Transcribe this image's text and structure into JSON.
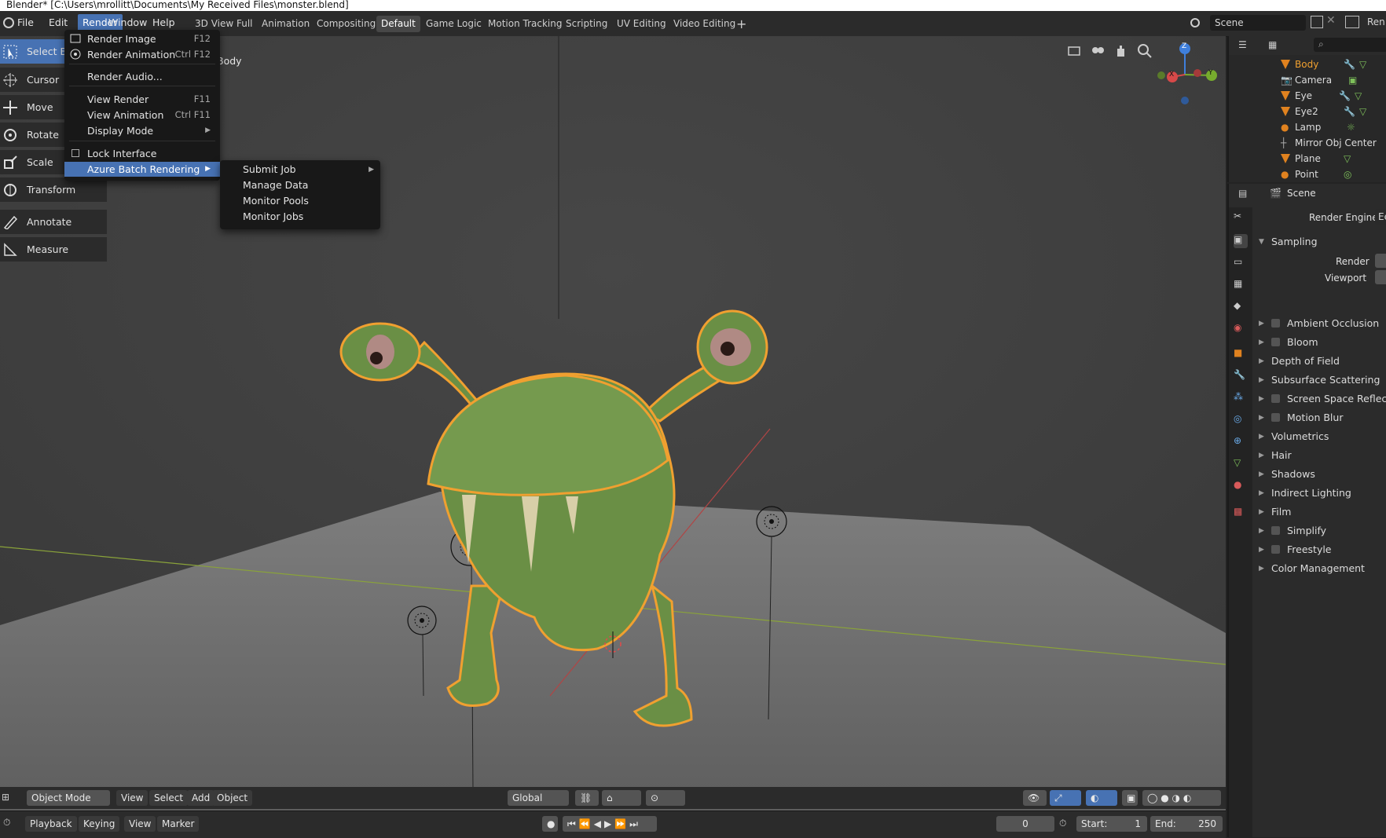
{
  "window": {
    "title": "Blender* [C:\\Users\\mrollitt\\Documents\\My Received Files\\monster.blend]"
  },
  "top_menu": [
    "File",
    "Edit",
    "Render",
    "Window",
    "Help"
  ],
  "workspace_tabs": [
    "3D View Full",
    "Animation",
    "Compositing",
    "Default",
    "Game Logic",
    "Motion Tracking",
    "Scripting",
    "UV Editing",
    "Video Editing"
  ],
  "workspace_active": "Default",
  "scene_selector": {
    "label": "Scene"
  },
  "render_menu": {
    "items": [
      {
        "label": "Render Image",
        "shortcut": "F12",
        "icon": "render-image-icon"
      },
      {
        "label": "Render Animation",
        "shortcut": "Ctrl F12",
        "icon": "render-animation-icon"
      },
      {
        "label": "Render Audio...",
        "shortcut": ""
      },
      {
        "label": "View Render",
        "shortcut": "F11"
      },
      {
        "label": "View Animation",
        "shortcut": "Ctrl F11"
      },
      {
        "label": "Display Mode",
        "shortcut": ""
      },
      {
        "label": "Lock Interface",
        "shortcut": ""
      },
      {
        "label": "Azure Batch Rendering",
        "shortcut": ""
      }
    ]
  },
  "azure_submenu": {
    "items": [
      "Submit Job",
      "Manage Data",
      "Monitor Pools",
      "Monitor Jobs"
    ]
  },
  "toolbar": {
    "tools": [
      "Select Box",
      "Cursor",
      "Move",
      "Rotate",
      "Scale",
      "Transform",
      "Annotate",
      "Measure"
    ]
  },
  "viewport": {
    "overlay_text": "Body"
  },
  "viewport_header": {
    "mode": "Object Mode",
    "menus": [
      "View",
      "Select",
      "Add",
      "Object"
    ],
    "orientation": "Global"
  },
  "gizmo": {
    "axis_x": "X",
    "axis_y": "Y",
    "axis_z": "Z"
  },
  "timeline": {
    "menus": [
      "Playback",
      "Keying",
      "View",
      "Marker"
    ],
    "current_frame": "0",
    "start_label": "Start:",
    "start": "1",
    "end_label": "End:",
    "end": "250"
  },
  "outliner": {
    "items": [
      {
        "name": "Body",
        "selected": true
      },
      {
        "name": "Camera",
        "selected": false
      },
      {
        "name": "Eye",
        "selected": false
      },
      {
        "name": "Eye2",
        "selected": false
      },
      {
        "name": "Lamp",
        "selected": false
      },
      {
        "name": "Mirror Obj Center",
        "selected": false
      },
      {
        "name": "Plane",
        "selected": false
      },
      {
        "name": "Point",
        "selected": false
      }
    ]
  },
  "properties": {
    "context": "Scene",
    "render_engine_label": "Render Engine",
    "render_engine_value": "Ee",
    "sampling": {
      "label": "Sampling",
      "render": "Render",
      "viewport": "Viewport"
    },
    "panels": [
      {
        "label": "Ambient Occlusion",
        "check": true
      },
      {
        "label": "Bloom",
        "check": true
      },
      {
        "label": "Depth of Field",
        "check": false
      },
      {
        "label": "Subsurface Scattering",
        "check": false
      },
      {
        "label": "Screen Space Reflections",
        "check": true
      },
      {
        "label": "Motion Blur",
        "check": true
      },
      {
        "label": "Volumetrics",
        "check": false
      },
      {
        "label": "Hair",
        "check": false
      },
      {
        "label": "Shadows",
        "check": false
      },
      {
        "label": "Indirect Lighting",
        "check": false
      },
      {
        "label": "Film",
        "check": false
      },
      {
        "label": "Simplify",
        "check": true
      },
      {
        "label": "Freestyle",
        "check": true
      },
      {
        "label": "Color Management",
        "check": false
      }
    ]
  },
  "colors": {
    "accent": "#4772b3",
    "selected_outline": "#f0a030",
    "monster_green": "#6a8f45"
  }
}
